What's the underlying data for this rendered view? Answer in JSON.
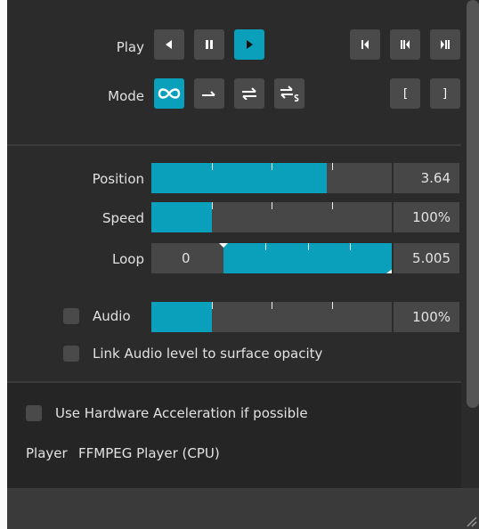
{
  "controls": {
    "play_label": "Play",
    "mode_label": "Mode"
  },
  "play_buttons": [
    {
      "icon": "play-backward-icon",
      "active": false
    },
    {
      "icon": "pause-icon",
      "active": false
    },
    {
      "icon": "play-forward-icon",
      "active": true
    }
  ],
  "seek_buttons": [
    {
      "icon": "skip-to-start-icon"
    },
    {
      "icon": "step-backward-icon"
    },
    {
      "icon": "step-forward-icon"
    }
  ],
  "mode_buttons": [
    {
      "icon": "loop-infinite-icon",
      "active": true
    },
    {
      "icon": "play-once-icon",
      "active": false
    },
    {
      "icon": "ping-pong-icon",
      "active": false
    },
    {
      "icon": "ping-pong-stop-icon",
      "active": false
    }
  ],
  "bracket_buttons": [
    {
      "text": "["
    },
    {
      "text": "]"
    }
  ],
  "sliders": {
    "position": {
      "label": "Position",
      "value": "3.64",
      "fill_fraction": 0.73
    },
    "speed": {
      "label": "Speed",
      "value": "100%",
      "fill_fraction": 0.25
    },
    "loop": {
      "label": "Loop",
      "start_value": "0",
      "end_value": "5.005",
      "range_start_fraction": 0.3,
      "range_end_fraction": 1.0
    },
    "audio": {
      "label": "Audio",
      "value": "100%",
      "fill_fraction": 0.25
    }
  },
  "checkboxes": {
    "audio_enabled": false,
    "link_audio_label": "Link Audio level to surface opacity",
    "hw_accel_label": "Use Hardware Acceleration if possible"
  },
  "player": {
    "label": "Player",
    "value": "FFMPEG Player (CPU)"
  },
  "colors": {
    "accent": "#0aa0bc",
    "panel_bg": "#2b2b2b",
    "control_bg": "#474747"
  }
}
